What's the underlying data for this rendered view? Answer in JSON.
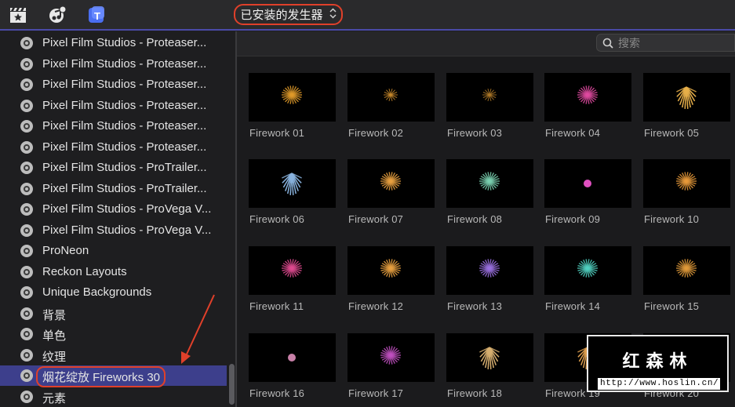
{
  "toolbar": {
    "icons": [
      "clapper-star-icon",
      "music-note-icon",
      "titles-icon"
    ],
    "dropdown_label": "已安装的发生器",
    "dropdown_chevron": "⌃⌄"
  },
  "search": {
    "placeholder": "搜索",
    "icon": "magnifier-icon"
  },
  "sidebar": {
    "items": [
      {
        "label": "Pixel Film Studios - Proteaser..."
      },
      {
        "label": "Pixel Film Studios - Proteaser..."
      },
      {
        "label": "Pixel Film Studios - Proteaser..."
      },
      {
        "label": "Pixel Film Studios - Proteaser..."
      },
      {
        "label": "Pixel Film Studios - Proteaser..."
      },
      {
        "label": "Pixel Film Studios - Proteaser..."
      },
      {
        "label": "Pixel Film Studios - ProTrailer..."
      },
      {
        "label": "Pixel Film Studios - ProTrailer..."
      },
      {
        "label": "Pixel Film Studios - ProVega V..."
      },
      {
        "label": "Pixel Film Studios - ProVega V..."
      },
      {
        "label": "ProNeon"
      },
      {
        "label": "Reckon Layouts"
      },
      {
        "label": "Unique Backgrounds"
      },
      {
        "label": "背景"
      },
      {
        "label": "单色"
      },
      {
        "label": "纹理"
      },
      {
        "label": "烟花绽放 Fireworks 30"
      },
      {
        "label": "元素"
      }
    ],
    "selected_index": 16
  },
  "tiles": [
    {
      "name": "Firework 01",
      "color": "#e09a2a",
      "style": "round"
    },
    {
      "name": "Firework 02",
      "color": "#c98a2c",
      "style": "small"
    },
    {
      "name": "Firework 03",
      "color": "#b07a28",
      "style": "small"
    },
    {
      "name": "Firework 04",
      "color": "#e04aa0",
      "style": "round"
    },
    {
      "name": "Firework 05",
      "color": "#e8b04a",
      "style": "willow"
    },
    {
      "name": "Firework 06",
      "color": "#8ab4e0",
      "style": "willow"
    },
    {
      "name": "Firework 07",
      "color": "#e8a040",
      "style": "round"
    },
    {
      "name": "Firework 08",
      "color": "#7ad0b0",
      "style": "round"
    },
    {
      "name": "Firework 09",
      "color": "#e050c0",
      "style": "dot"
    },
    {
      "name": "Firework 10",
      "color": "#e89a3a",
      "style": "round"
    },
    {
      "name": "Firework 11",
      "color": "#e04a90",
      "style": "round"
    },
    {
      "name": "Firework 12",
      "color": "#e8a040",
      "style": "round"
    },
    {
      "name": "Firework 13",
      "color": "#9a70e0",
      "style": "round"
    },
    {
      "name": "Firework 14",
      "color": "#50d0c0",
      "style": "round"
    },
    {
      "name": "Firework 15",
      "color": "#e09a3a",
      "style": "round"
    },
    {
      "name": "Firework 16",
      "color": "#c880a8",
      "style": "dot"
    },
    {
      "name": "Firework 17",
      "color": "#c050c0",
      "style": "round"
    },
    {
      "name": "Firework 18",
      "color": "#d8b070",
      "style": "willow"
    },
    {
      "name": "Firework 19",
      "color": "#e0a050",
      "style": "willow"
    },
    {
      "name": "Firework 20",
      "color": "#b0a080",
      "style": "willow"
    }
  ],
  "watermark": {
    "title": "红森林",
    "url": "http://www.hoslin.cn/"
  },
  "colors": {
    "selection": "#3d3f8c",
    "highlight_outline": "#e0402a",
    "arrow": "#e0402a"
  }
}
